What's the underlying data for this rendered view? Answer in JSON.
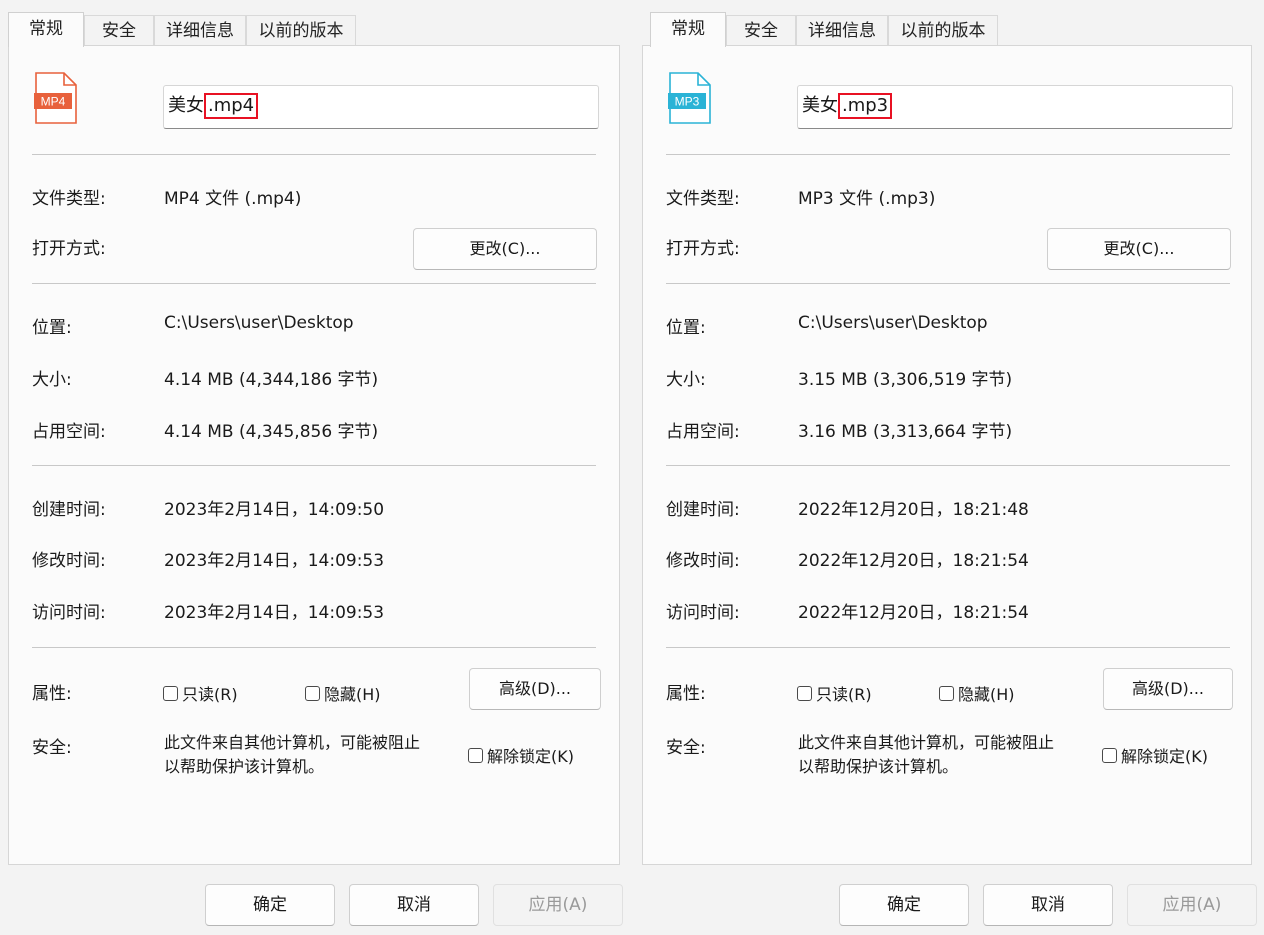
{
  "tabs": [
    "常规",
    "安全",
    "详细信息",
    "以前的版本"
  ],
  "labels": {
    "file_type": "文件类型:",
    "open_with": "打开方式:",
    "location": "位置:",
    "size": "大小:",
    "size_on_disk": "占用空间:",
    "created": "创建时间:",
    "modified": "修改时间:",
    "accessed": "访问时间:",
    "attributes": "属性:",
    "security": "安全:"
  },
  "buttons": {
    "change": "更改(C)...",
    "advanced": "高级(D)...",
    "ok": "确定",
    "cancel": "取消",
    "apply": "应用(A)"
  },
  "checkboxes": {
    "readonly": "只读(R)",
    "hidden": "隐藏(H)",
    "unblock": "解除锁定(K)"
  },
  "security_text": [
    "此文件来自其他计算机，可能被阻止",
    "以帮助保护该计算机。"
  ],
  "left": {
    "icon_text": "MP4",
    "icon_color": "#e8613c",
    "name_base": "美女",
    "name_ext": ".mp4",
    "file_type": "MP4 文件 (.mp4)",
    "location": "C:\\Users\\user\\Desktop",
    "size": "4.14 MB (4,344,186 字节)",
    "size_on_disk": "4.14 MB (4,345,856 字节)",
    "created": "2023年2月14日，14:09:50",
    "modified": "2023年2月14日，14:09:53",
    "accessed": "2023年2月14日，14:09:53"
  },
  "right": {
    "icon_text": "MP3",
    "icon_color": "#2ab3d6",
    "name_base": "美女",
    "name_ext": ".mp3",
    "file_type": "MP3 文件 (.mp3)",
    "location": "C:\\Users\\user\\Desktop",
    "size": "3.15 MB (3,306,519 字节)",
    "size_on_disk": "3.16 MB (3,313,664 字节)",
    "created": "2022年12月20日，18:21:48",
    "modified": "2022年12月20日，18:21:54",
    "accessed": "2022年12月20日，18:21:54"
  },
  "colors": {
    "highlight": "#e81123"
  }
}
